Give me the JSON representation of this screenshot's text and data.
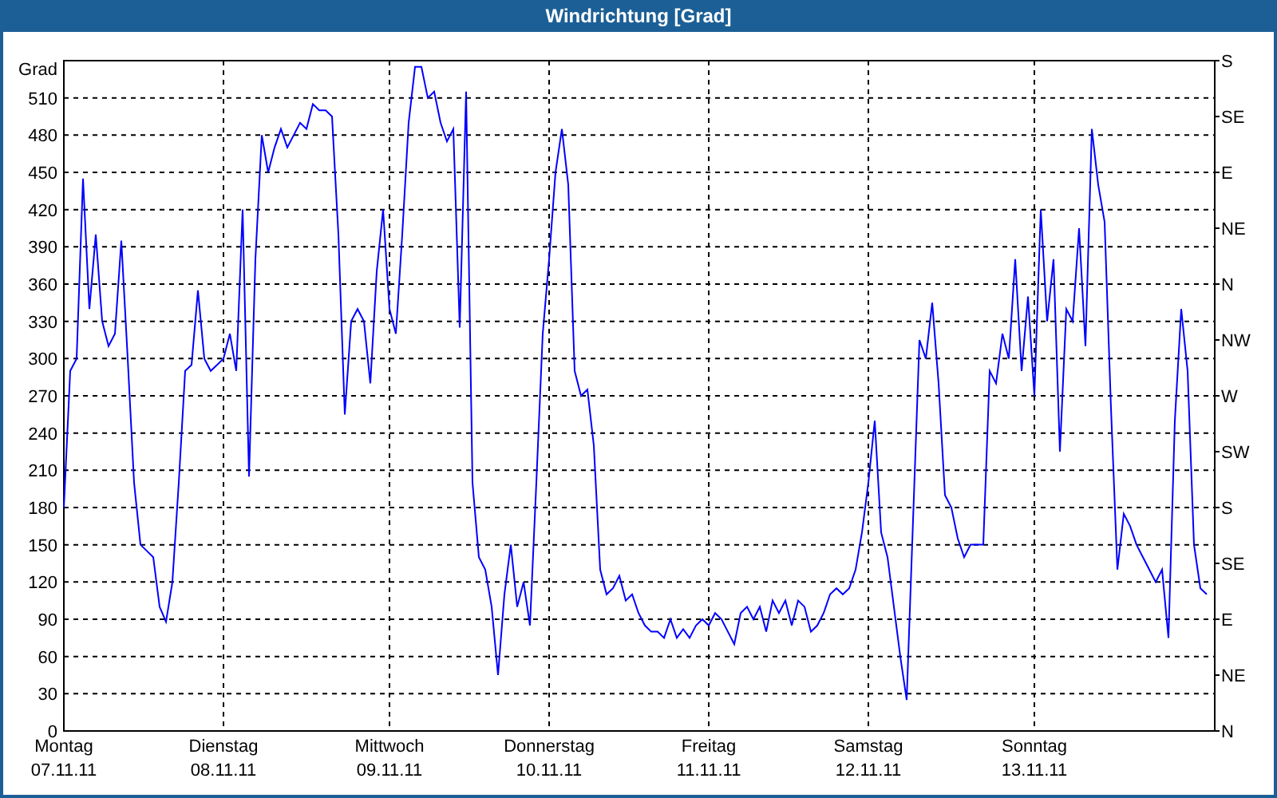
{
  "window": {
    "title": "Windrichtung [Grad]"
  },
  "chart": {
    "direction_labels": [
      "S",
      "SE",
      "E",
      "NE",
      "N",
      "NW",
      "W",
      "SW",
      "S",
      "SE",
      "E",
      "NE",
      "N"
    ],
    "chart_data": {
      "type": "line",
      "grid": true,
      "ylabel": "Grad",
      "ylim": [
        0,
        540
      ],
      "yticks": [
        0,
        30,
        60,
        90,
        120,
        150,
        180,
        210,
        240,
        270,
        300,
        330,
        360,
        390,
        420,
        450,
        480,
        510
      ],
      "categories": [
        "Montag 07.11.11",
        null,
        null,
        null,
        null,
        null,
        null,
        null,
        null,
        null,
        null,
        null,
        null,
        null,
        null,
        null,
        null,
        null,
        null,
        null,
        null,
        null,
        null,
        null,
        null,
        "Dienstag 08.11.11",
        null,
        null,
        null,
        null,
        null,
        null,
        null,
        null,
        null,
        null,
        null,
        null,
        null,
        null,
        null,
        null,
        null,
        null,
        null,
        null,
        null,
        null,
        null,
        null,
        null,
        "Mittwoch 09.11.11",
        null,
        null,
        null,
        null,
        null,
        null,
        null,
        null,
        null,
        null,
        null,
        null,
        null,
        null,
        null,
        null,
        null,
        null,
        null,
        null,
        null,
        null,
        null,
        null,
        "Donnerstag 10.11.11",
        null,
        null,
        null,
        null,
        null,
        null,
        null,
        null,
        null,
        null,
        null,
        null,
        null,
        null,
        null,
        null,
        null,
        null,
        null,
        null,
        null,
        null,
        null,
        null,
        "Freitag 11.11.11",
        null,
        null,
        null,
        null,
        null,
        null,
        null,
        null,
        null,
        null,
        null,
        null,
        null,
        null,
        null,
        null,
        null,
        null,
        null,
        null,
        null,
        null,
        null,
        null,
        "Samstag 12.11.11",
        null,
        null,
        null,
        null,
        null,
        null,
        null,
        null,
        null,
        null,
        null,
        null,
        null,
        null,
        null,
        null,
        null,
        null,
        null,
        null,
        null,
        null,
        null,
        null,
        null,
        "Sonntag 13.11.11",
        null,
        null,
        null,
        null,
        null,
        null,
        null,
        null,
        null,
        null,
        null,
        null,
        null,
        null,
        null,
        null,
        null,
        null,
        null,
        null,
        null,
        null,
        null,
        null,
        null,
        null,
        null
      ],
      "series": [
        {
          "color": "#0000ff",
          "values": [
            180,
            290,
            300,
            445,
            340,
            400,
            330,
            310,
            320,
            395,
            300,
            200,
            150,
            145,
            140,
            100,
            88,
            120,
            200,
            290,
            295,
            355,
            300,
            290,
            295,
            300,
            320,
            290,
            420,
            205,
            380,
            480,
            450,
            470,
            485,
            470,
            480,
            490,
            485,
            505,
            500,
            500,
            495,
            400,
            255,
            330,
            340,
            330,
            280,
            370,
            420,
            340,
            320,
            400,
            490,
            535,
            535,
            510,
            515,
            490,
            475,
            485,
            325,
            515,
            200,
            140,
            130,
            100,
            45,
            110,
            150,
            100,
            120,
            85,
            200,
            320,
            380,
            450,
            485,
            440,
            290,
            270,
            275,
            230,
            130,
            110,
            115,
            125,
            105,
            110,
            95,
            85,
            80,
            80,
            75,
            90,
            75,
            82,
            75,
            85,
            90,
            85,
            95,
            90,
            80,
            70,
            95,
            100,
            90,
            100,
            80,
            105,
            95,
            105,
            85,
            105,
            100,
            80,
            85,
            95,
            110,
            115,
            110,
            115,
            130,
            160,
            200,
            250,
            160,
            140,
            100,
            60,
            25,
            170,
            315,
            300,
            345,
            280,
            190,
            180,
            155,
            140,
            150,
            150,
            150,
            290,
            280,
            320,
            300,
            380,
            290,
            350,
            270,
            420,
            330,
            380,
            225,
            340,
            330,
            405,
            310,
            485,
            440,
            410,
            260,
            130,
            175,
            165,
            150,
            140,
            130,
            120,
            130,
            75,
            250,
            340,
            290,
            150,
            115,
            110
          ]
        }
      ]
    }
  }
}
